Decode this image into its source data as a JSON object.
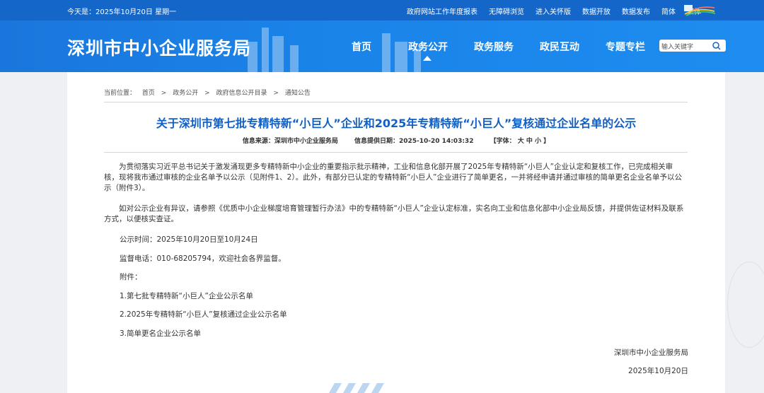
{
  "topbar": {
    "date": "今天是：2025年10月20日 星期一",
    "links": [
      "政府网站工作年度报表",
      "无障碍浏览",
      "进入关怀版",
      "数据开放",
      "数据发布",
      "简体",
      "繁体"
    ]
  },
  "header": {
    "site_title": "深圳市中小企业服务局",
    "nav": [
      "首页",
      "政务公开",
      "政务服务",
      "政民互动",
      "专题专栏"
    ],
    "active_nav": "政务公开",
    "search_placeholder": "输入关键字"
  },
  "breadcrumb": [
    "当前位置：",
    "首页",
    ">",
    "政务公开",
    ">",
    "政府信息公开目录",
    ">",
    "通知公告"
  ],
  "article": {
    "title": "关于深圳市第七批专精特新“小巨人”企业和2025年专精特新“小巨人”复核通过企业名单的公示",
    "source": "信息来源：深圳市中小企业服务局",
    "date": "信息提供日期：2025-10-20 14:03:32",
    "font_size": "【字体： 大  中  小 】",
    "para1": "为贯彻落实习近平总书记关于激发涌现更多专精特新中小企业的重要指示批示精神，工业和信息化部开展了2025年专精特新“小巨人”企业认定和复核工作，已完成相关审核，现将我市通过审核的企业名单予以公示（见附件1、2）。此外，有部分已认定的专精特新“小巨人”企业进行了简单更名，一并将经申请并通过审核的简单更名企业名单予以公示（附件3）。",
    "para2": "如对公示企业有异议，请参照《优质中小企业梯度培育管理暂行办法》中的专精特新“小巨人”企业认定标准，实名向工业和信息化部中小企业局反馈，并提供佐证材料及联系方式，以便核实查证。",
    "period": "公示时间：2025年10月20日至10月24日",
    "phone": "监督电话：010-68205794，欢迎社会各界监督。",
    "attach_label": "附件：",
    "attachments": [
      "1.第七批专精特新“小巨人”企业公示名单",
      "2.2025年专精特新“小巨人”复核通过企业公示名单",
      "3.简单更名企业公示名单"
    ],
    "signer": "深圳市中小企业服务局",
    "sign_date": "2025年10月20日"
  },
  "colors": {
    "brand_blue": "#1466c8",
    "title_blue": "#1260c4"
  }
}
